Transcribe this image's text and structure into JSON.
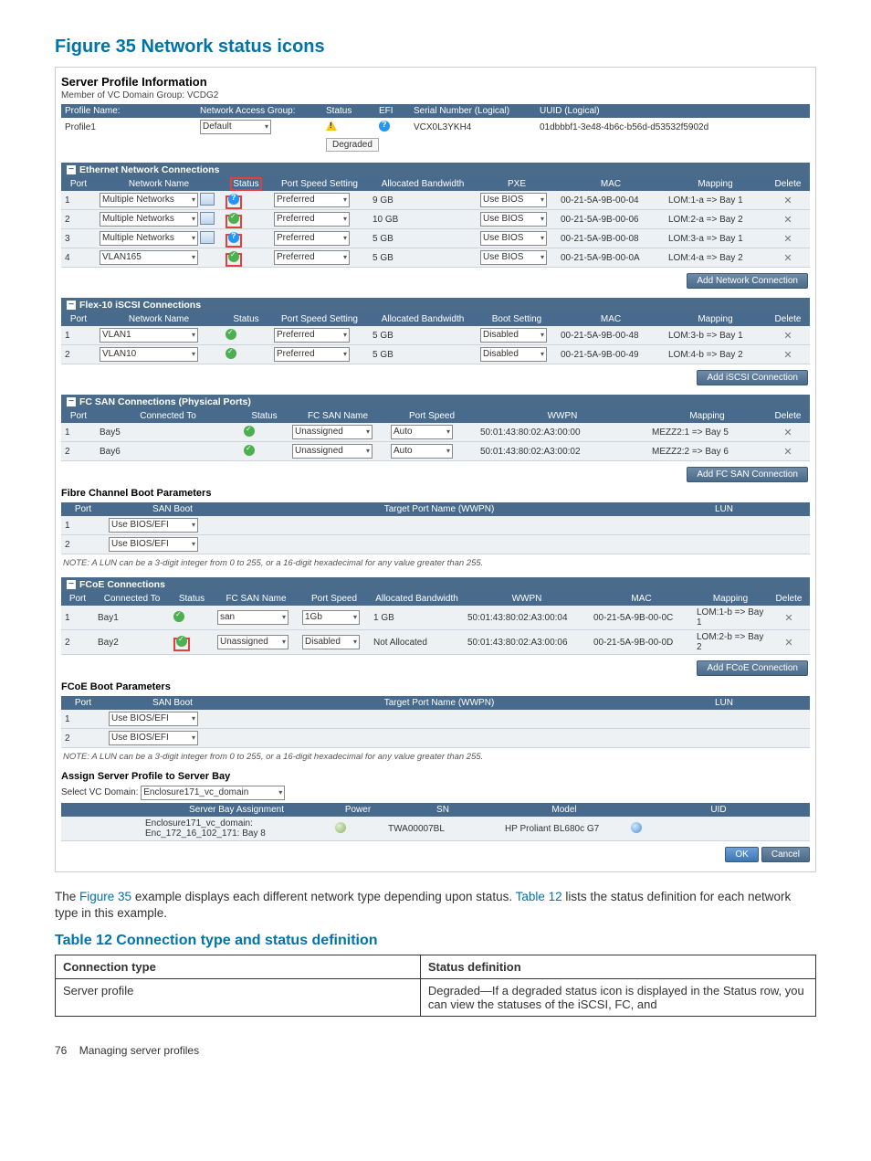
{
  "figure_title": "Figure 35 Network status icons",
  "profile_info_title": "Server Profile Information",
  "member_text": "Member of VC Domain Group: VCDG2",
  "top": {
    "profile_name_lbl": "Profile Name:",
    "profile_name_val": "Profile1",
    "nag_lbl": "Network Access Group:",
    "nag_val": "Default",
    "status_lbl": "Status",
    "efi_lbl": "EFI",
    "serial_lbl": "Serial Number (Logical)",
    "serial_val": "VCX0L3YKH4",
    "uuid_lbl": "UUID (Logical)",
    "uuid_val": "01dbbbf1-3e48-4b6c-b56d-d53532f5902d",
    "degraded": "Degraded"
  },
  "eth": {
    "title": "Ethernet Network Connections",
    "cols": [
      "Port",
      "Network Name",
      "Status",
      "Port Speed Setting",
      "Allocated Bandwidth",
      "PXE",
      "MAC",
      "Mapping",
      "Delete"
    ],
    "rows": [
      {
        "port": "1",
        "net": "Multiple Networks",
        "status": "q",
        "speed": "Preferred",
        "bw": "9 GB",
        "pxe": "Use BIOS",
        "mac": "00-21-5A-9B-00-04",
        "map": "LOM:1-a => Bay 1"
      },
      {
        "port": "2",
        "net": "Multiple Networks",
        "status": "ok",
        "speed": "Preferred",
        "bw": "10 GB",
        "pxe": "Use BIOS",
        "mac": "00-21-5A-9B-00-06",
        "map": "LOM:2-a => Bay 2"
      },
      {
        "port": "3",
        "net": "Multiple Networks",
        "status": "q",
        "speed": "Preferred",
        "bw": "5 GB",
        "pxe": "Use BIOS",
        "mac": "00-21-5A-9B-00-08",
        "map": "LOM:3-a => Bay 1"
      },
      {
        "port": "4",
        "net": "VLAN165",
        "status": "ok",
        "speed": "Preferred",
        "bw": "5 GB",
        "pxe": "Use BIOS",
        "mac": "00-21-5A-9B-00-0A",
        "map": "LOM:4-a => Bay 2"
      }
    ],
    "add_btn": "Add Network Connection"
  },
  "iscsi": {
    "title": "Flex-10 iSCSI Connections",
    "cols": [
      "Port",
      "Network Name",
      "Status",
      "Port Speed Setting",
      "Allocated Bandwidth",
      "Boot Setting",
      "MAC",
      "Mapping",
      "Delete"
    ],
    "rows": [
      {
        "port": "1",
        "net": "VLAN1",
        "status": "ok",
        "speed": "Preferred",
        "bw": "5 GB",
        "boot": "Disabled",
        "mac": "00-21-5A-9B-00-48",
        "map": "LOM:3-b => Bay 1"
      },
      {
        "port": "2",
        "net": "VLAN10",
        "status": "ok",
        "speed": "Preferred",
        "bw": "5 GB",
        "boot": "Disabled",
        "mac": "00-21-5A-9B-00-49",
        "map": "LOM:4-b => Bay 2"
      }
    ],
    "add_btn": "Add iSCSI Connection"
  },
  "fcsan": {
    "title": "FC SAN Connections (Physical Ports)",
    "cols": [
      "Port",
      "Connected To",
      "Status",
      "FC SAN Name",
      "Port Speed",
      "WWPN",
      "Mapping",
      "Delete"
    ],
    "rows": [
      {
        "port": "1",
        "conn": "Bay5",
        "status": "ok",
        "name": "Unassigned",
        "speed": "Auto",
        "wwpn": "50:01:43:80:02:A3:00:00",
        "map": "MEZZ2:1 => Bay 5"
      },
      {
        "port": "2",
        "conn": "Bay6",
        "status": "ok",
        "name": "Unassigned",
        "speed": "Auto",
        "wwpn": "50:01:43:80:02:A3:00:02",
        "map": "MEZZ2:2 => Bay 6"
      }
    ],
    "add_btn": "Add FC SAN Connection"
  },
  "fc_boot": {
    "title": "Fibre Channel Boot Parameters",
    "cols": [
      "Port",
      "SAN Boot",
      "Target Port Name (WWPN)",
      "LUN"
    ],
    "rows": [
      {
        "port": "1",
        "boot": "Use BIOS/EFI"
      },
      {
        "port": "2",
        "boot": "Use BIOS/EFI"
      }
    ],
    "note": "NOTE: A LUN can be a 3-digit integer from 0 to 255, or a 16-digit hexadecimal for any value greater than 255."
  },
  "fcoe": {
    "title": "FCoE Connections",
    "cols": [
      "Port",
      "Connected To",
      "Status",
      "FC SAN Name",
      "Port Speed",
      "Allocated Bandwidth",
      "WWPN",
      "MAC",
      "Mapping",
      "Delete"
    ],
    "rows": [
      {
        "port": "1",
        "conn": "Bay1",
        "status": "ok",
        "name": "san",
        "speed": "1Gb",
        "bw": "1 GB",
        "wwpn": "50:01:43:80:02:A3:00:04",
        "mac": "00-21-5A-9B-00-0C",
        "map": "LOM:1-b => Bay 1"
      },
      {
        "port": "2",
        "conn": "Bay2",
        "status": "ok",
        "name": "Unassigned",
        "speed": "Disabled",
        "bw": "Not Allocated",
        "wwpn": "50:01:43:80:02:A3:00:06",
        "mac": "00-21-5A-9B-00-0D",
        "map": "LOM:2-b => Bay 2"
      }
    ],
    "add_btn": "Add FCoE Connection"
  },
  "fcoe_boot": {
    "title": "FCoE Boot Parameters",
    "cols": [
      "Port",
      "SAN Boot",
      "Target Port Name (WWPN)",
      "LUN"
    ],
    "rows": [
      {
        "port": "1",
        "boot": "Use BIOS/EFI"
      },
      {
        "port": "2",
        "boot": "Use BIOS/EFI"
      }
    ],
    "note": "NOTE: A LUN can be a 3-digit integer from 0 to 255, or a 16-digit hexadecimal for any value greater than 255."
  },
  "assign": {
    "title": "Assign Server Profile to Server Bay",
    "select_lbl": "Select VC Domain:",
    "select_val": "Enclosure171_vc_domain",
    "cols": [
      "",
      "Server Bay Assignment",
      "Power",
      "SN",
      "Model",
      "UID"
    ],
    "row": {
      "assign": "Enclosure171_vc_domain: Enc_172_16_102_171: Bay 8",
      "sn": "TWA00007BL",
      "model": "HP Proliant BL680c G7"
    }
  },
  "ok_btn": "OK",
  "cancel_btn": "Cancel",
  "body_text_1": "The ",
  "body_text_link1": "Figure 35",
  "body_text_2": " example displays each different network type depending upon status. ",
  "body_text_link2": "Table 12",
  "body_text_3": " lists the status definition for each network type in this example.",
  "table_title": "Table 12 Connection type and status definition",
  "doc_table": {
    "h1": "Connection type",
    "h2": "Status definition",
    "r1c1": "Server profile",
    "r1c2": "Degraded—If a degraded status icon is displayed in the Status row, you can view the statuses of the iSCSI, FC, and"
  },
  "page_num": "76",
  "page_label": "Managing server profiles"
}
